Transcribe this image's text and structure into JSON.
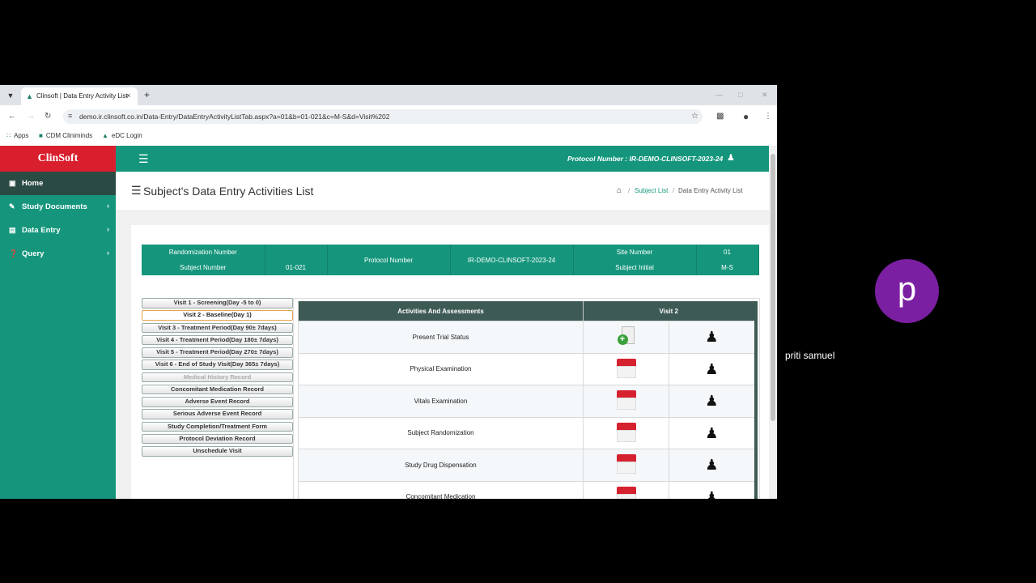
{
  "browser": {
    "tab_title": "Clinsoft | Data Entry Activity List",
    "tab_close": "×",
    "new_tab": "+",
    "url": "demo.ir.clinsoft.co.in/Data-Entry/DataEntryActivityListTab.aspx?a=01&b=01-021&c=M-S&d=Visit%202",
    "bookmarks": [
      "Apps",
      "CDM Cliniminds",
      "eDC Login"
    ]
  },
  "app": {
    "brand": "ClinSoft",
    "header_protocol": "Protocol Number : IR-DEMO-CLINSOFT-2023-24",
    "sidebar": [
      {
        "label": "Home",
        "icon": "laptop-icon",
        "active": true
      },
      {
        "label": "Study Documents",
        "icon": "edit-icon"
      },
      {
        "label": "Data Entry",
        "icon": "file-icon"
      },
      {
        "label": "Query",
        "icon": "question-icon"
      }
    ],
    "page_title": "Subject's Data Entry Activities List",
    "breadcrumb": [
      "Subject List",
      "Data Entry Activity List"
    ]
  },
  "info": {
    "randomization_label": "Randomization Number",
    "randomization_value": "",
    "subject_label": "Subject Number",
    "subject_value": "01-021",
    "protocol_label": "Protocol Number",
    "protocol_value": "IR-DEMO-CLINSOFT-2023-24",
    "site_label": "Site Number",
    "site_value": "01",
    "initial_label": "Subject Initial",
    "initial_value": "M-S"
  },
  "visits": [
    "Visit 1 - Screening(Day -5 to 0)",
    "Visit 2 - Baseline(Day 1)",
    "Visit 3 - Treatment Period(Day 90± 7days)",
    "Visit 4 - Treatment Period(Day 180± 7days)",
    "Visit 5 - Treatment Period(Day 270± 7days)",
    "Visit 6 - End of Study Visit(Day 365± 7days)",
    "Medical History Record",
    "Concomitant Medication Record",
    "Adverse Event Record",
    "Serious Adverse Event Record",
    "Study Completion/Treatment Form",
    "Protocol Deviation Record",
    "Unschedule Visit"
  ],
  "activities_header": "Activities And Assessments",
  "visit_header": "Visit 2",
  "activities": [
    "Present Trial Status",
    "Physical Examination",
    "Vitals Examination",
    "Subject Randomization",
    "Study Drug Dispensation",
    "Concomitant Medication"
  ],
  "participant": {
    "initial": "p",
    "name": "priti samuel"
  },
  "colors": {
    "primary": "#15967c",
    "brand_red": "#d91f2e",
    "header_dark": "#3d5a55",
    "avatar": "#7b1fa2"
  }
}
